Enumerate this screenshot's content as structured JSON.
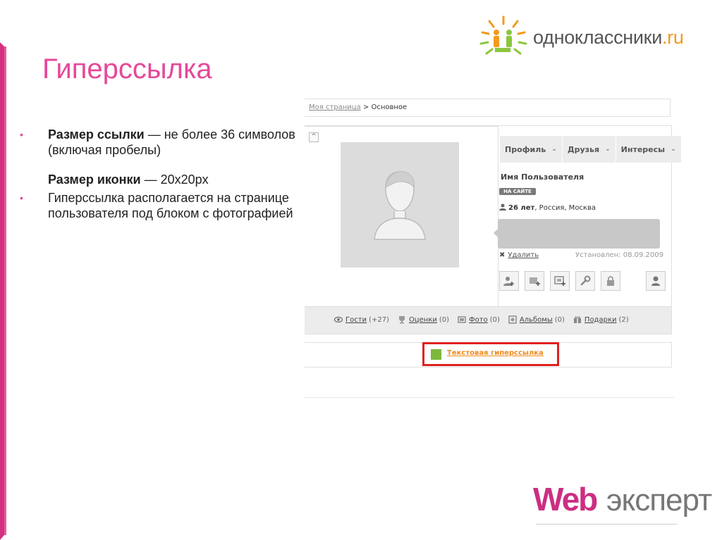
{
  "slide": {
    "title": "Гиперссылка",
    "bullet1_bold": "Размер ссылки",
    "bullet1_rest": " — не более 36 символов (включая пробелы)",
    "sub_bold": "Размер иконки",
    "sub_rest": " — 20х20px",
    "bullet2": "Гиперссылка располагается на странице пользователя под блоком с фотографией",
    "bullet_marker": "•"
  },
  "logo": {
    "ok_name": "одноклассники",
    "ok_tld": ".ru",
    "web": "Web",
    "expert": "эксперт"
  },
  "screenshot": {
    "breadcrumb_link": "Моя страница",
    "breadcrumb_sep": " > ",
    "breadcrumb_current": "Основное",
    "collapse_glyph": "^",
    "tabs": [
      "Профиль",
      "Друзья",
      "Интересы"
    ],
    "tab_chevron": "⌄",
    "user_name": "Имя Пользователя",
    "online_badge": "НА САЙТЕ",
    "age": "26 лет",
    "location": ", Россия, Москва",
    "delete_x": "✖",
    "delete_label": "Удалить",
    "installed": "Установлен: 08.09.2009",
    "stats": [
      {
        "label": "Гости",
        "count": "(+27)"
      },
      {
        "label": "Оценки",
        "count": "(0)"
      },
      {
        "label": "Фото",
        "count": "(0)"
      },
      {
        "label": "Альбомы",
        "count": "(0)"
      },
      {
        "label": "Подарки",
        "count": "(2)"
      }
    ],
    "text_link": "Текстовая гиперссылка"
  },
  "colors": {
    "title_pink": "#e64899",
    "link_orange": "#f08a1a",
    "highlight_red": "#e02020",
    "icon_green": "#7cb83b"
  }
}
